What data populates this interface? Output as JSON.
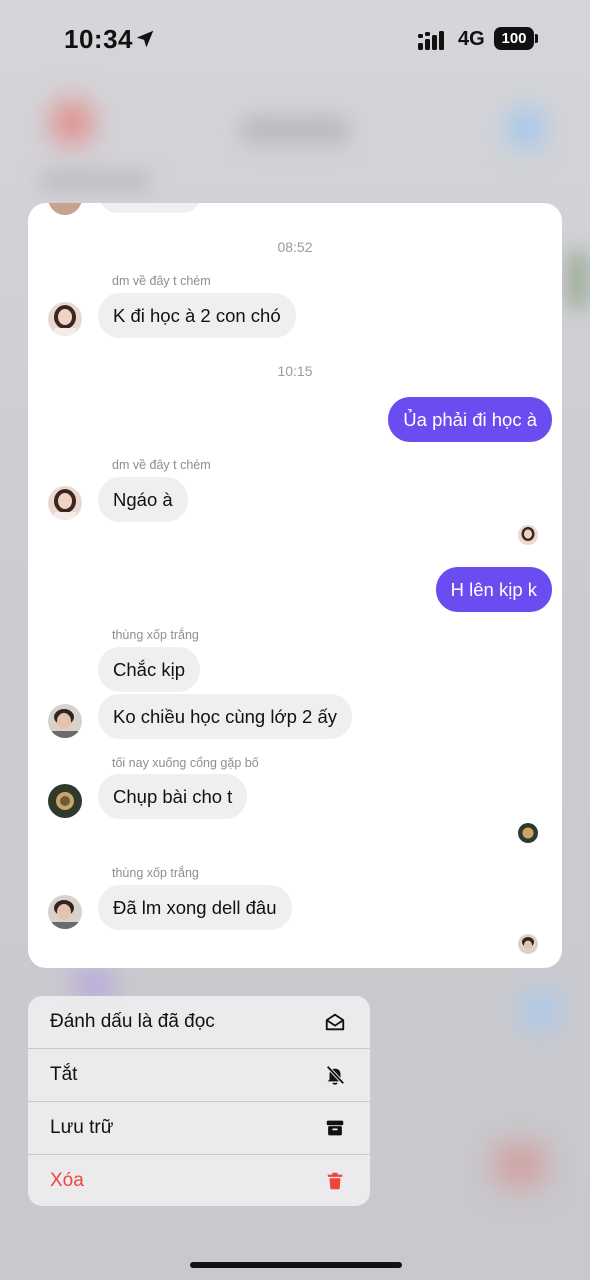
{
  "status_bar": {
    "time": "10:34",
    "network": "4G",
    "battery": "100"
  },
  "chat": {
    "timestamps": [
      "08:52",
      "10:15"
    ],
    "messages": [
      {
        "sender": "dm về đây t chém",
        "text": "K đi học à 2 con chó",
        "direction": "in"
      },
      {
        "text": "Ủa phải đi học à",
        "direction": "out"
      },
      {
        "sender": "dm về đây t chém",
        "text": "Ngáo à",
        "direction": "in"
      },
      {
        "text": "H lên kịp k",
        "direction": "out"
      },
      {
        "sender": "thùng xốp trắng",
        "text": "Chắc kịp",
        "direction": "in"
      },
      {
        "text": "Ko chiều học cùng lớp 2 ấy",
        "direction": "in"
      },
      {
        "sender": "tối nay xuống cổng gặp bố",
        "text": "Chụp bài cho t",
        "direction": "in"
      },
      {
        "sender": "thùng xốp trắng",
        "text": "Đã lm xong dell đâu",
        "direction": "in"
      }
    ],
    "outgoing_color": "#6a4cf1"
  },
  "menu": {
    "items": [
      {
        "label": "Đánh dấu là đã đọc",
        "icon": "mark-read-icon"
      },
      {
        "label": "Tắt",
        "icon": "mute-bell-icon"
      },
      {
        "label": "Lưu trữ",
        "icon": "archive-icon"
      },
      {
        "label": "Xóa",
        "icon": "trash-icon",
        "color": "#f0453a"
      }
    ]
  }
}
